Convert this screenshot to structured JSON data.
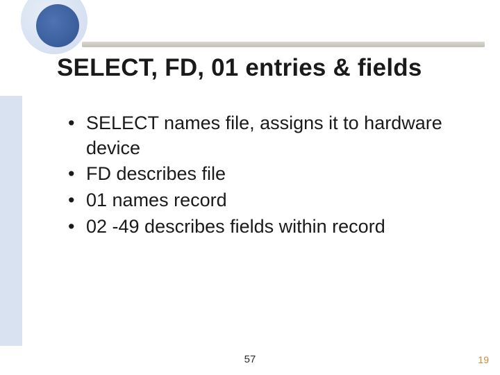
{
  "title": "SELECT, FD, 01 entries & fields",
  "bullets": [
    "SELECT names file, assigns it to hardware device",
    "FD describes file",
    "01 names record",
    "02 -49 describes fields within record"
  ],
  "footer": {
    "center": "57",
    "right": "19"
  }
}
